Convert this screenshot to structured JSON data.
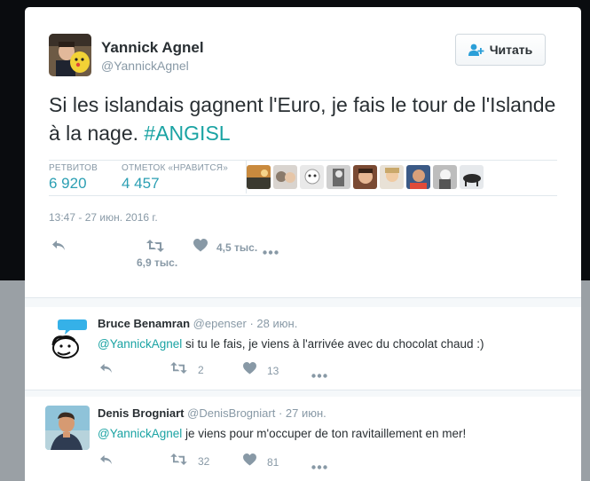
{
  "tweet": {
    "author_name": "Yannick Agnel",
    "author_handle": "@YannickAgnel",
    "follow_label": "Читать",
    "text_main": "Si les islandais gagnent l'Euro, je fais le tour de l'Islande à la nage. ",
    "hashtag": "#ANGISL",
    "retweets_label": "РЕТВИТОВ",
    "retweets_value": "6 920",
    "likes_label": "ОТМЕТОК «НРАВИТСЯ»",
    "likes_value": "4 457",
    "timestamp": "13:47 - 27 июн. 2016 г.",
    "retweet_count": "6,9 тыс.",
    "like_count": "4,5 тыс."
  },
  "replies": [
    {
      "name": "Bruce Benamran",
      "handle": "@epenser",
      "date": "· 28 июн.",
      "mention": "@YannickAgnel",
      "text": " si tu le fais, je viens à l'arrivée avec du chocolat chaud :)",
      "retweets": "2",
      "likes": "13"
    },
    {
      "name": "Denis Brogniart",
      "handle": "@DenisBrogniart",
      "date": "· 27 июн.",
      "mention": "@YannickAgnel",
      "text": " je viens pour m'occuper de ton ravitaillement en mer!",
      "retweets": "32",
      "likes": "81"
    }
  ],
  "colors": {
    "accent": "#1aa3a3",
    "stat": "#2b9fb3",
    "muted": "#8899a6",
    "text": "#292f33"
  },
  "icons": [
    "user-plus-icon",
    "reply-icon",
    "retweet-icon",
    "heart-icon",
    "more-icon"
  ]
}
